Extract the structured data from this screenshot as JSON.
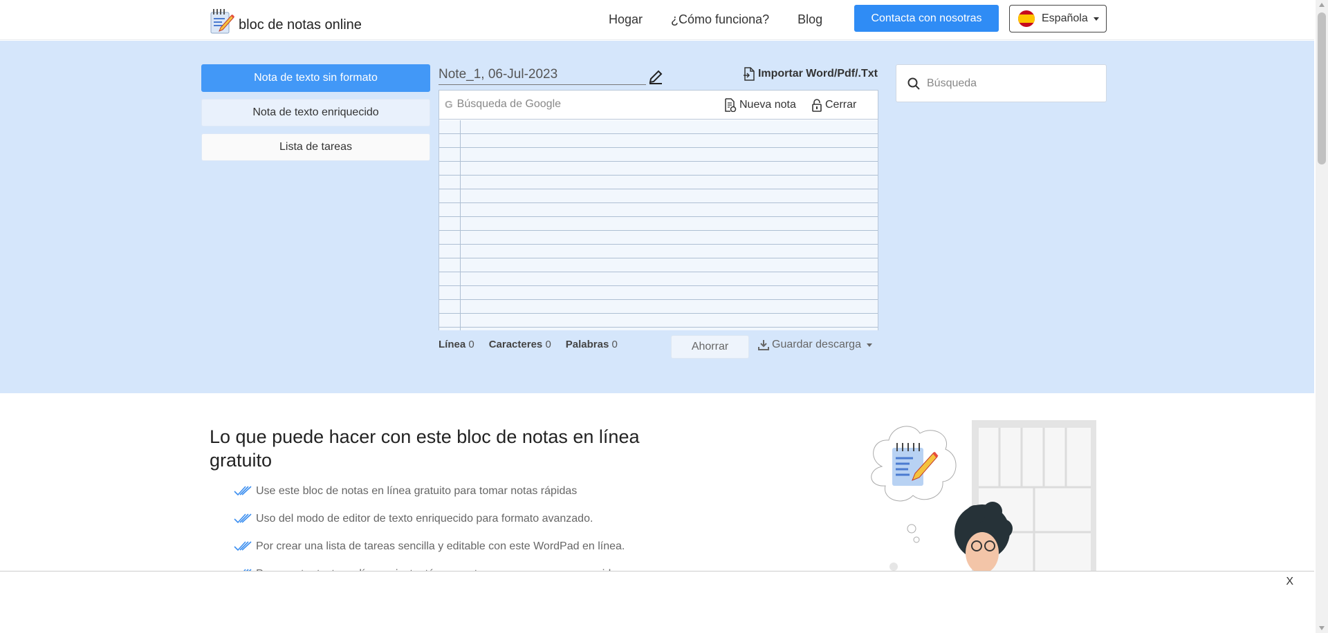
{
  "brand": {
    "name": "bloc de notas online",
    "icon": "notepad-pencil-icon"
  },
  "nav": {
    "links": [
      "Hogar",
      "¿Cómo funciona?",
      "Blog"
    ],
    "contact_label": "Contacta con nosotras",
    "language": "Española",
    "language_flag": "spain-flag-icon"
  },
  "sidebar": {
    "items": [
      {
        "label": "Nota de texto sin formato",
        "active": true
      },
      {
        "label": "Nota de texto enriquecido",
        "active": false
      },
      {
        "label": "Lista de tareas",
        "active": false
      }
    ]
  },
  "editor": {
    "note_title": "Note_1, 06-Jul-2023",
    "import_label": "Importar Word/Pdf/.Txt",
    "google_search_placeholder": "Búsqueda de Google",
    "new_note_label": "Nueva nota",
    "close_label": "Cerrar",
    "stats": {
      "line_label": "Línea",
      "line_value": "0",
      "chars_label": "Caracteres",
      "chars_value": "0",
      "words_label": "Palabras",
      "words_value": "0"
    },
    "save_label": "Ahorrar",
    "download_label": "Guardar descarga"
  },
  "search": {
    "placeholder": "Búsqueda"
  },
  "content": {
    "headline": "Lo que puede hacer con este bloc de notas en línea gratuito",
    "features": [
      "Use este bloc de notas en línea gratuito para tomar notas rápidas",
      "Uso del modo de editor de texto enriquecido para formato avanzado.",
      "Por crear una lista de tareas sencilla y editable con este WordPad en línea.",
      "Para anotar texto en línea e instantáneamente para conservar nuevas ideas."
    ]
  },
  "ad": {
    "close_label": "X"
  },
  "colors": {
    "accent": "#2f8cf5",
    "hero_bg": "#d5e6fb",
    "active_tab": "#4298f7"
  }
}
